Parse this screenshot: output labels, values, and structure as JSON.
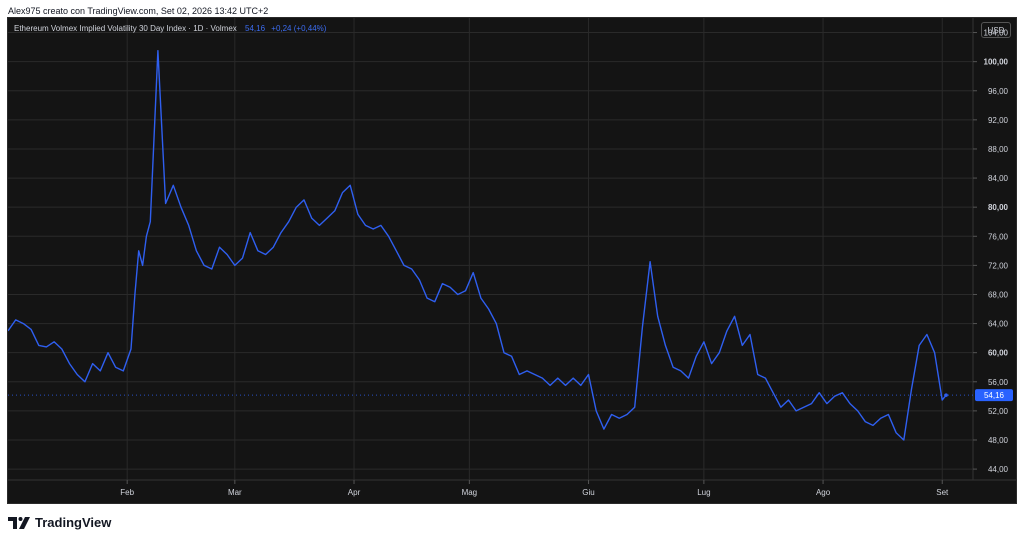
{
  "caption": "Alex975 creato con TradingView.com, Set 02, 2026 13:42 UTC+2",
  "legend": {
    "title": "Ethereum Volmex Implied Volatility 30 Day Index · 1D · Volmex",
    "last": "54,16",
    "change": "+0,24 (+0,44%)"
  },
  "currency": "USD",
  "brand": {
    "name": "TradingView",
    "icon": "tradingview-logo-icon"
  },
  "colors": {
    "line": "#2f5ff0",
    "background": "#141414",
    "grid": "#2a2a2a",
    "text": "#d1d4dc",
    "badge": "#2962ff"
  },
  "chart_data": {
    "type": "line",
    "series": [
      {
        "x": [
          "2026-01-01",
          "2026-01-03",
          "2026-01-05",
          "2026-01-07",
          "2026-01-09",
          "2026-01-11",
          "2026-01-13",
          "2026-01-15",
          "2026-01-17",
          "2026-01-19",
          "2026-01-21",
          "2026-01-23",
          "2026-01-25",
          "2026-01-27",
          "2026-01-29",
          "2026-01-31",
          "2026-02-02",
          "2026-02-03",
          "2026-02-04",
          "2026-02-05",
          "2026-02-06",
          "2026-02-07",
          "2026-02-09",
          "2026-02-11",
          "2026-02-13",
          "2026-02-15",
          "2026-02-17",
          "2026-02-19",
          "2026-02-21",
          "2026-02-23",
          "2026-02-25",
          "2026-02-27",
          "2026-03-01",
          "2026-03-03",
          "2026-03-05",
          "2026-03-07",
          "2026-03-09",
          "2026-03-11",
          "2026-03-13",
          "2026-03-15",
          "2026-03-17",
          "2026-03-19",
          "2026-03-21",
          "2026-03-23",
          "2026-03-25",
          "2026-03-27",
          "2026-03-29",
          "2026-03-31",
          "2026-04-02",
          "2026-04-04",
          "2026-04-06",
          "2026-04-08",
          "2026-04-10",
          "2026-04-12",
          "2026-04-14",
          "2026-04-16",
          "2026-04-18",
          "2026-04-20",
          "2026-04-22",
          "2026-04-24",
          "2026-04-26",
          "2026-04-28",
          "2026-04-30",
          "2026-05-02",
          "2026-05-04",
          "2026-05-06",
          "2026-05-08",
          "2026-05-10",
          "2026-05-12",
          "2026-05-14",
          "2026-05-16",
          "2026-05-18",
          "2026-05-20",
          "2026-05-22",
          "2026-05-24",
          "2026-05-26",
          "2026-05-28",
          "2026-05-30",
          "2026-06-01",
          "2026-06-03",
          "2026-06-05",
          "2026-06-07",
          "2026-06-09",
          "2026-06-11",
          "2026-06-13",
          "2026-06-15",
          "2026-06-17",
          "2026-06-19",
          "2026-06-21",
          "2026-06-23",
          "2026-06-25",
          "2026-06-27",
          "2026-06-29",
          "2026-07-01",
          "2026-07-03",
          "2026-07-05",
          "2026-07-07",
          "2026-07-09",
          "2026-07-11",
          "2026-07-13",
          "2026-07-15",
          "2026-07-17",
          "2026-07-19",
          "2026-07-21",
          "2026-07-23",
          "2026-07-25",
          "2026-07-27",
          "2026-07-29",
          "2026-07-31",
          "2026-08-02",
          "2026-08-04",
          "2026-08-06",
          "2026-08-08",
          "2026-08-10",
          "2026-08-12",
          "2026-08-14",
          "2026-08-16",
          "2026-08-18",
          "2026-08-20",
          "2026-08-22",
          "2026-08-24",
          "2026-08-26",
          "2026-08-28",
          "2026-08-30",
          "2026-09-01",
          "2026-09-02"
        ],
        "y": [
          63.0,
          64.5,
          64.0,
          63.2,
          61.0,
          60.8,
          61.5,
          60.5,
          58.5,
          57.0,
          56.0,
          58.5,
          57.5,
          60.0,
          58.0,
          57.5,
          60.5,
          68.0,
          74.0,
          72.0,
          76.0,
          78.0,
          101.5,
          80.5,
          83.0,
          80.0,
          77.5,
          74.0,
          72.0,
          71.5,
          74.5,
          73.5,
          72.0,
          73.0,
          76.5,
          74.0,
          73.5,
          74.5,
          76.5,
          78.0,
          80.0,
          81.0,
          78.5,
          77.5,
          78.5,
          79.5,
          82.0,
          83.0,
          79.0,
          77.5,
          77.0,
          77.5,
          76.0,
          74.0,
          72.0,
          71.5,
          70.0,
          67.5,
          67.0,
          69.5,
          69.0,
          68.0,
          68.5,
          71.0,
          67.5,
          66.0,
          64.0,
          60.0,
          59.5,
          57.0,
          57.5,
          57.0,
          56.5,
          55.5,
          56.5,
          55.5,
          56.5,
          55.5,
          57.0,
          52.0,
          49.5,
          51.5,
          51.0,
          51.5,
          52.5,
          63.5,
          72.5,
          65.0,
          61.0,
          58.0,
          57.5,
          56.5,
          59.5,
          61.5,
          58.5,
          60.0,
          63.0,
          65.0,
          61.0,
          62.5,
          57.0,
          56.5,
          54.5,
          52.5,
          53.5,
          52.0,
          52.5,
          53.0,
          54.5,
          53.0,
          54.0,
          54.5,
          53.0,
          52.0,
          50.5,
          50.0,
          51.0,
          51.5,
          49.0,
          48.0,
          55.0,
          61.0,
          62.5,
          60.0,
          53.5,
          54.16
        ]
      }
    ],
    "y_ticks": [
      "104,00",
      "100,00",
      "96,00",
      "92,00",
      "88,00",
      "84,00",
      "80,00",
      "76,00",
      "72,00",
      "68,00",
      "64,00",
      "60,00",
      "56,00",
      "52,00",
      "48,00",
      "44,00"
    ],
    "y_tick_values": [
      104,
      100,
      96,
      92,
      88,
      84,
      80,
      76,
      72,
      68,
      64,
      60,
      56,
      52,
      48,
      44
    ],
    "x_ticks": [
      "Feb",
      "Mar",
      "Apr",
      "Mag",
      "Giu",
      "Lug",
      "Ago",
      "Set"
    ],
    "x_tick_dates": [
      "2026-02-01",
      "2026-03-01",
      "2026-04-01",
      "2026-05-01",
      "2026-06-01",
      "2026-07-01",
      "2026-08-01",
      "2026-09-01"
    ],
    "ylim": [
      42.5,
      106
    ],
    "xlim": [
      "2026-01-01",
      "2026-09-09"
    ],
    "grid": true,
    "price_label": "54,16",
    "last_value": 54.16
  }
}
